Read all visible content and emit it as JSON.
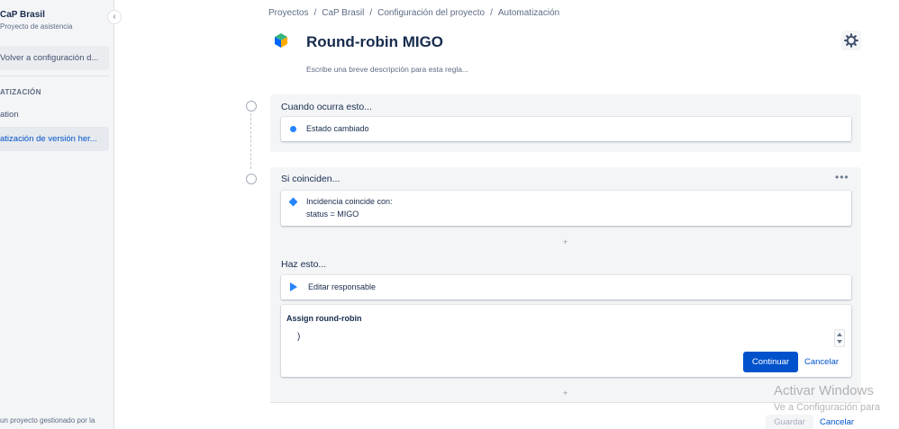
{
  "sidebar": {
    "project_name": "CaP Brasil",
    "project_type": "Proyecto de asistencia",
    "collapse_glyph": "‹",
    "back_label": "Volver a configuración d...",
    "section_heading": "ATIZACIÓN",
    "items": [
      {
        "label": "ation"
      },
      {
        "label": "atización de versión her..."
      }
    ],
    "footer": "un proyecto gestionado por la"
  },
  "breadcrumb": {
    "items": [
      "Proyectos",
      "CaP Brasil",
      "Configuración del proyecto",
      "Automatización"
    ],
    "separator": "/"
  },
  "header": {
    "title": "Round-robin MIGO",
    "description_placeholder": "Escribe una breve descripción para esta regla..."
  },
  "trigger_panel": {
    "title": "Cuando ocurra esto...",
    "card_label": "Estado cambiado"
  },
  "condition_panel": {
    "title": "Si coinciden...",
    "more_glyph": "•••",
    "condition_line1": "Incidencia coincide con:",
    "condition_line2": "status = MIGO",
    "add_glyph": "+",
    "action_heading": "Haz esto...",
    "action_label": "Editar responsable",
    "form": {
      "title": "Assign round-robin",
      "field_value": ")",
      "continue_label": "Continuar",
      "cancel_label": "Cancelar"
    },
    "bottom_add_glyph": "+"
  },
  "footer": {
    "save_label": "Guardar",
    "cancel_label": "Cancelar"
  },
  "watermark": {
    "line1": "Activar Windows",
    "line2": "Ve a Configuración para"
  },
  "colors": {
    "primary": "#0052cc",
    "accent_icon": "#2684ff",
    "panel_bg": "#f4f5f7",
    "text": "#172b4d"
  }
}
